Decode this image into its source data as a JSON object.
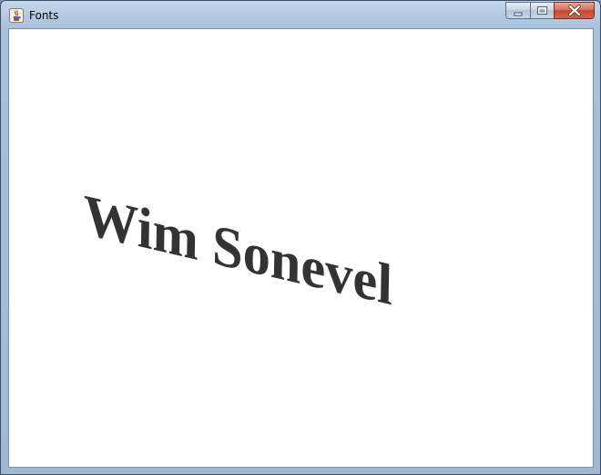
{
  "window": {
    "title": "Fonts",
    "icon": "java-cup-icon"
  },
  "titlebar": {
    "buttons": [
      "minimize",
      "maximize",
      "close"
    ]
  },
  "canvas": {
    "text": "Wim Sonevel",
    "text_color": "#333333",
    "background": "#ffffff"
  }
}
